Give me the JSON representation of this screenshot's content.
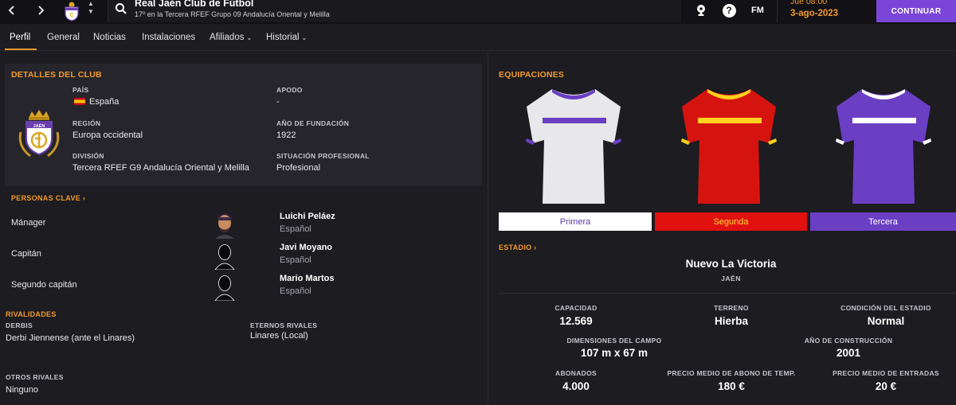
{
  "header": {
    "club_name": "Real Jaén Club de Fútbol",
    "club_subtitle": "17º en la Tercera RFEF Grupo 09 Andalucía Oriental y Melilla",
    "fm_label": "FM",
    "help_label": "?",
    "time": "Jue 08:00",
    "date": "3-ago-2023",
    "continue_label": "CONTINUAR"
  },
  "tabs": [
    {
      "label": "Perfil",
      "active": true
    },
    {
      "label": "General"
    },
    {
      "label": "Noticias"
    },
    {
      "label": "Instalaciones"
    },
    {
      "label": "Afiliados",
      "dropdown": true
    },
    {
      "label": "Historial",
      "dropdown": true
    }
  ],
  "club_details": {
    "title": "DETALLES DEL CLUB",
    "country_label": "PAÍS",
    "country": "España",
    "nickname_label": "APODO",
    "nickname": "-",
    "region_label": "REGIÓN",
    "region": "Europa occidental",
    "founded_label": "AÑO DE FUNDACIÓN",
    "founded": "1922",
    "division_label": "DIVISIÓN",
    "division": "Tercera RFEF G9 Andalucía Oriental y Melilla",
    "status_label": "SITUACIÓN PROFESIONAL",
    "status": "Profesional",
    "crest_text": "JAÉN"
  },
  "key_people": {
    "title": "PERSONAS CLAVE ›",
    "people": [
      {
        "role": "Mánager",
        "name": "Luichi Peláez",
        "nationality": "Español"
      },
      {
        "role": "Capitán",
        "name": "Javi Moyano",
        "nationality": "Español"
      },
      {
        "role": "Segundo capitán",
        "name": "Mario Martos",
        "nationality": "Español"
      }
    ]
  },
  "rivalries": {
    "title": "RIVALIDADES",
    "derbies_label": "DERBIS",
    "derbies": "Derbi Jiennense (ante el Linares)",
    "eternal_label": "ETERNOS RIVALES",
    "eternal": "Linares (Local)",
    "others_label": "OTROS RIVALES",
    "others": "Ninguno"
  },
  "kits": {
    "title": "EQUIPACIONES",
    "items": [
      {
        "label": "Primera",
        "bar_color": "#ffffff",
        "text_color": "#5b3aa6"
      },
      {
        "label": "Segunda",
        "bar_color": "#e0110f",
        "text_color": "#ffdd33"
      },
      {
        "label": "Tercera",
        "bar_color": "#6a3fc4",
        "text_color": "#ffffff"
      }
    ]
  },
  "stadium": {
    "title": "ESTADIO ›",
    "name": "Nuevo La Victoria",
    "city": "JAÉN",
    "capacity_label": "CAPACIDAD",
    "capacity": "12.569",
    "surface_label": "TERRENO",
    "surface": "Hierba",
    "condition_label": "CONDICIÓN DEL ESTADIO",
    "condition": "Normal",
    "dimensions_label": "DIMENSIONES DEL CAMPO",
    "dimensions": "107 m x 67 m",
    "built_label": "AÑO DE CONSTRUCCIÓN",
    "built": "2001",
    "season_tickets_label": "ABONADOS",
    "season_tickets": "4.000",
    "avg_season_price_label": "PRECIO MEDIO DE ABONO DE TEMP.",
    "avg_season_price": "180 €",
    "avg_ticket_price_label": "PRECIO MEDIO DE ENTRADAS",
    "avg_ticket_price": "20 €"
  }
}
